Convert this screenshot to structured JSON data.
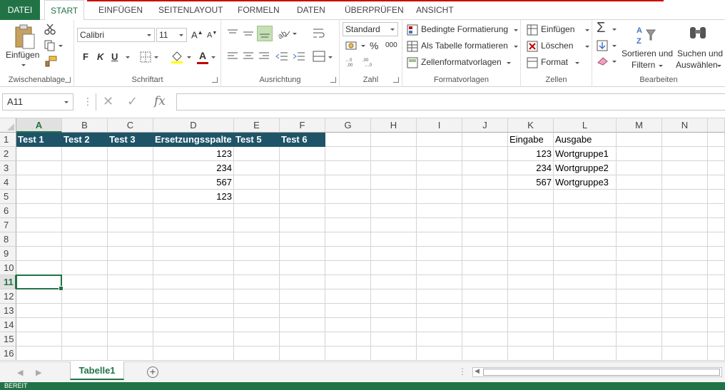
{
  "ribbon": {
    "file_tab": "DATEI",
    "tabs": [
      "START",
      "EINFÜGEN",
      "SEITENLAYOUT",
      "FORMELN",
      "DATEN",
      "ÜBERPRÜFEN",
      "ANSICHT"
    ],
    "active_tab": "START",
    "clipboard": {
      "paste_label": "Einfügen",
      "group_label": "Zwischenablage"
    },
    "font": {
      "font_name": "Calibri",
      "font_size": "11",
      "bold": "F",
      "italic": "K",
      "underline": "U",
      "group_label": "Schriftart"
    },
    "alignment": {
      "group_label": "Ausrichtung"
    },
    "number": {
      "format": "Standard",
      "percent": "%",
      "thousands": "000",
      "group_label": "Zahl"
    },
    "styles": {
      "conditional": "Bedingte Formatierung",
      "as_table": "Als Tabelle formatieren",
      "cell_styles": "Zellenformatvorlagen",
      "group_label": "Formatvorlagen"
    },
    "cells": {
      "insert": "Einfügen",
      "delete": "Löschen",
      "format": "Format",
      "group_label": "Zellen"
    },
    "editing": {
      "sort_line1": "Sortieren und",
      "sort_line2": "Filtern",
      "find_line1": "Suchen und",
      "find_line2": "Auswählen",
      "group_label": "Bearbeiten"
    }
  },
  "formula_bar": {
    "name_box": "A11",
    "fx": "fx",
    "formula": ""
  },
  "grid": {
    "columns": [
      "A",
      "B",
      "C",
      "D",
      "E",
      "F",
      "G",
      "H",
      "I",
      "J",
      "K",
      "L",
      "M",
      "N"
    ],
    "rows": [
      "1",
      "2",
      "3",
      "4",
      "5",
      "6",
      "7",
      "8",
      "9",
      "10",
      "11",
      "12",
      "13",
      "14",
      "15",
      "16"
    ],
    "selected_column": "A",
    "selected_row": "11",
    "table_headers": [
      "Test 1",
      "Test 2",
      "Test 3",
      "Ersetzungsspalte",
      "Test 5",
      "Test 6"
    ],
    "column_d_values": [
      "123",
      "234",
      "567",
      "123"
    ],
    "lookup": {
      "header_k": "Eingabe",
      "header_l": "Ausgabe",
      "k_values": [
        "123",
        "234",
        "567"
      ],
      "l_values": [
        "Wortgruppe1",
        "Wortgruppe2",
        "Wortgruppe3"
      ]
    }
  },
  "sheets": {
    "active": "Tabelle1"
  },
  "status": {
    "text": "BEREIT"
  },
  "colors": {
    "accent": "#217346",
    "table_header_bg": "#1f5468",
    "font_color": "#c00000",
    "fill_color": "#ffff00"
  }
}
